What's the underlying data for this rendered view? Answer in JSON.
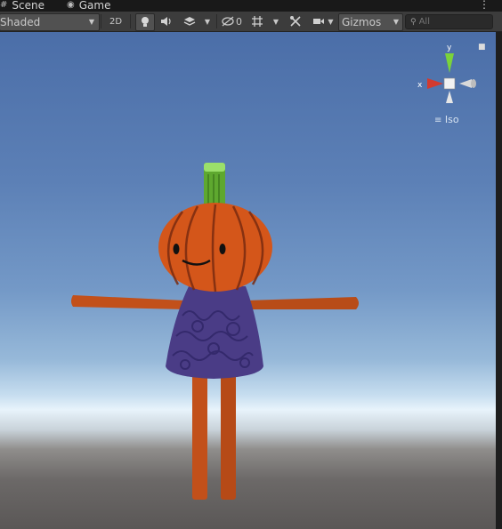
{
  "tabs": [
    {
      "label": "Scene",
      "icon": "grid-icon"
    },
    {
      "label": "Game",
      "icon": "gamepad-icon"
    }
  ],
  "tab_menu_icon": "kebab-menu-icon",
  "toolbar": {
    "shading_mode": "Shaded",
    "two_d_label": "2D",
    "hidden_count": "0",
    "gizmos_label": "Gizmos",
    "search_placeholder": "All"
  },
  "gizmo": {
    "x_label": "x",
    "y_label": "y",
    "projection_label": "Iso",
    "colors": {
      "x": "#d23a2f",
      "y": "#7bd33a",
      "z": "#dadada"
    }
  },
  "colors": {
    "sky_top": "#4b6ea8",
    "horizon": "#e8f3fb",
    "ground": "#5a5756",
    "pumpkin": "#d4561a",
    "stem": "#5ea82f",
    "dress": "#4a3c86",
    "limbs": "#c2501a"
  }
}
